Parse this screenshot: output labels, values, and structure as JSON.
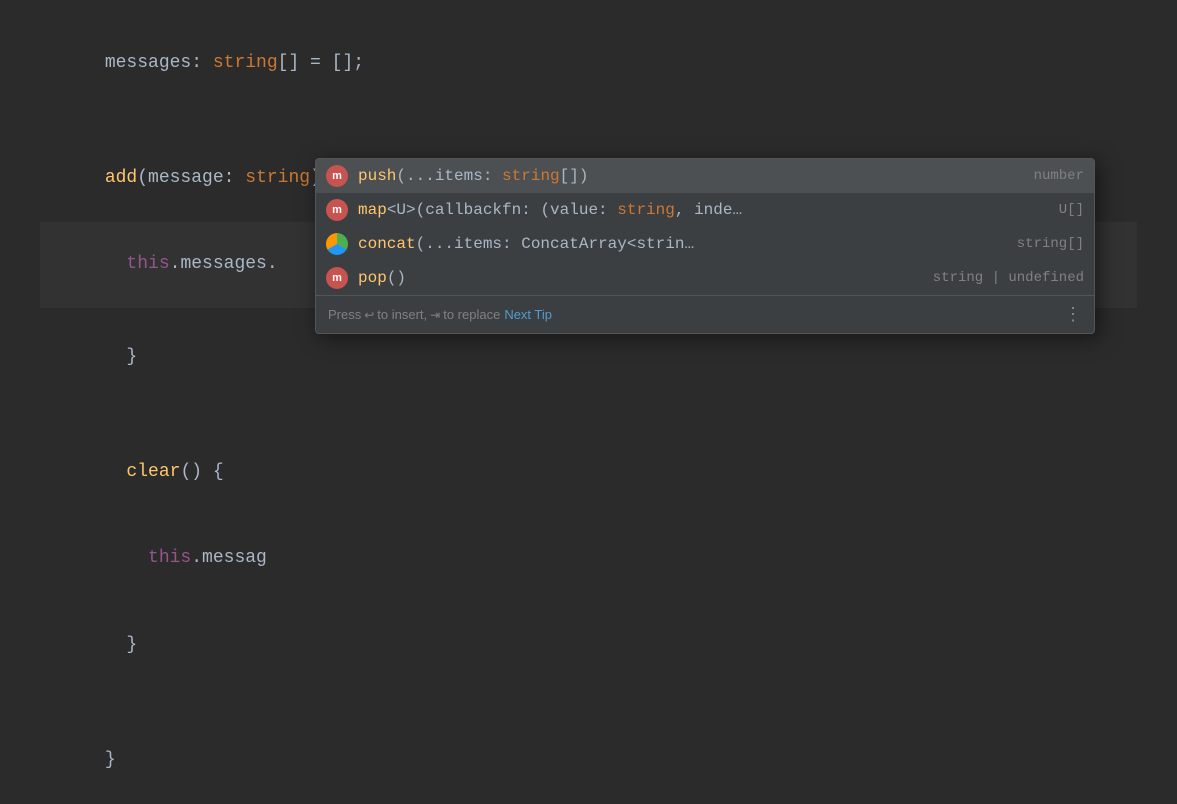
{
  "editor": {
    "background": "#2b2b2b",
    "lines": [
      {
        "id": "line1",
        "indent": 2,
        "content": "messages: string[] = [];"
      },
      {
        "id": "line2",
        "indent": 0,
        "content": ""
      },
      {
        "id": "line3",
        "indent": 2,
        "content": "add(message: string) {"
      },
      {
        "id": "line4",
        "indent": 4,
        "content": "this.messages."
      },
      {
        "id": "line5",
        "indent": 2,
        "content": "}"
      },
      {
        "id": "line6",
        "indent": 0,
        "content": ""
      },
      {
        "id": "line7",
        "indent": 2,
        "content": "clear() {"
      },
      {
        "id": "line8",
        "indent": 4,
        "content": "this.messag"
      },
      {
        "id": "line9",
        "indent": 2,
        "content": "}"
      },
      {
        "id": "line10",
        "indent": 0,
        "content": ""
      },
      {
        "id": "line11",
        "indent": 0,
        "content": "}"
      }
    ]
  },
  "autocomplete": {
    "items": [
      {
        "id": "push",
        "icon_type": "method",
        "icon_label": "m",
        "name": "push",
        "params": "(...items: string[])",
        "return_type": "number",
        "selected": true
      },
      {
        "id": "map",
        "icon_type": "method",
        "icon_label": "m",
        "name": "map",
        "params": "<U>(callbackfn: (value: string, inde…",
        "return_type": "U[]",
        "selected": false
      },
      {
        "id": "concat",
        "icon_type": "concat",
        "icon_label": "",
        "name": "concat",
        "params": "(...items: ConcatArray<strin…",
        "return_type": "string[]",
        "selected": false
      },
      {
        "id": "pop",
        "icon_type": "method",
        "icon_label": "m",
        "name": "pop",
        "params": "()",
        "return_type": "string | undefined",
        "selected": false
      }
    ],
    "footer": {
      "press_label": "Press",
      "enter_symbol": "↩",
      "to_insert": "to insert,",
      "tab_symbol": "⇥",
      "to_replace": "to replace",
      "next_tip_label": "Next Tip",
      "more_symbol": "⋮"
    }
  }
}
